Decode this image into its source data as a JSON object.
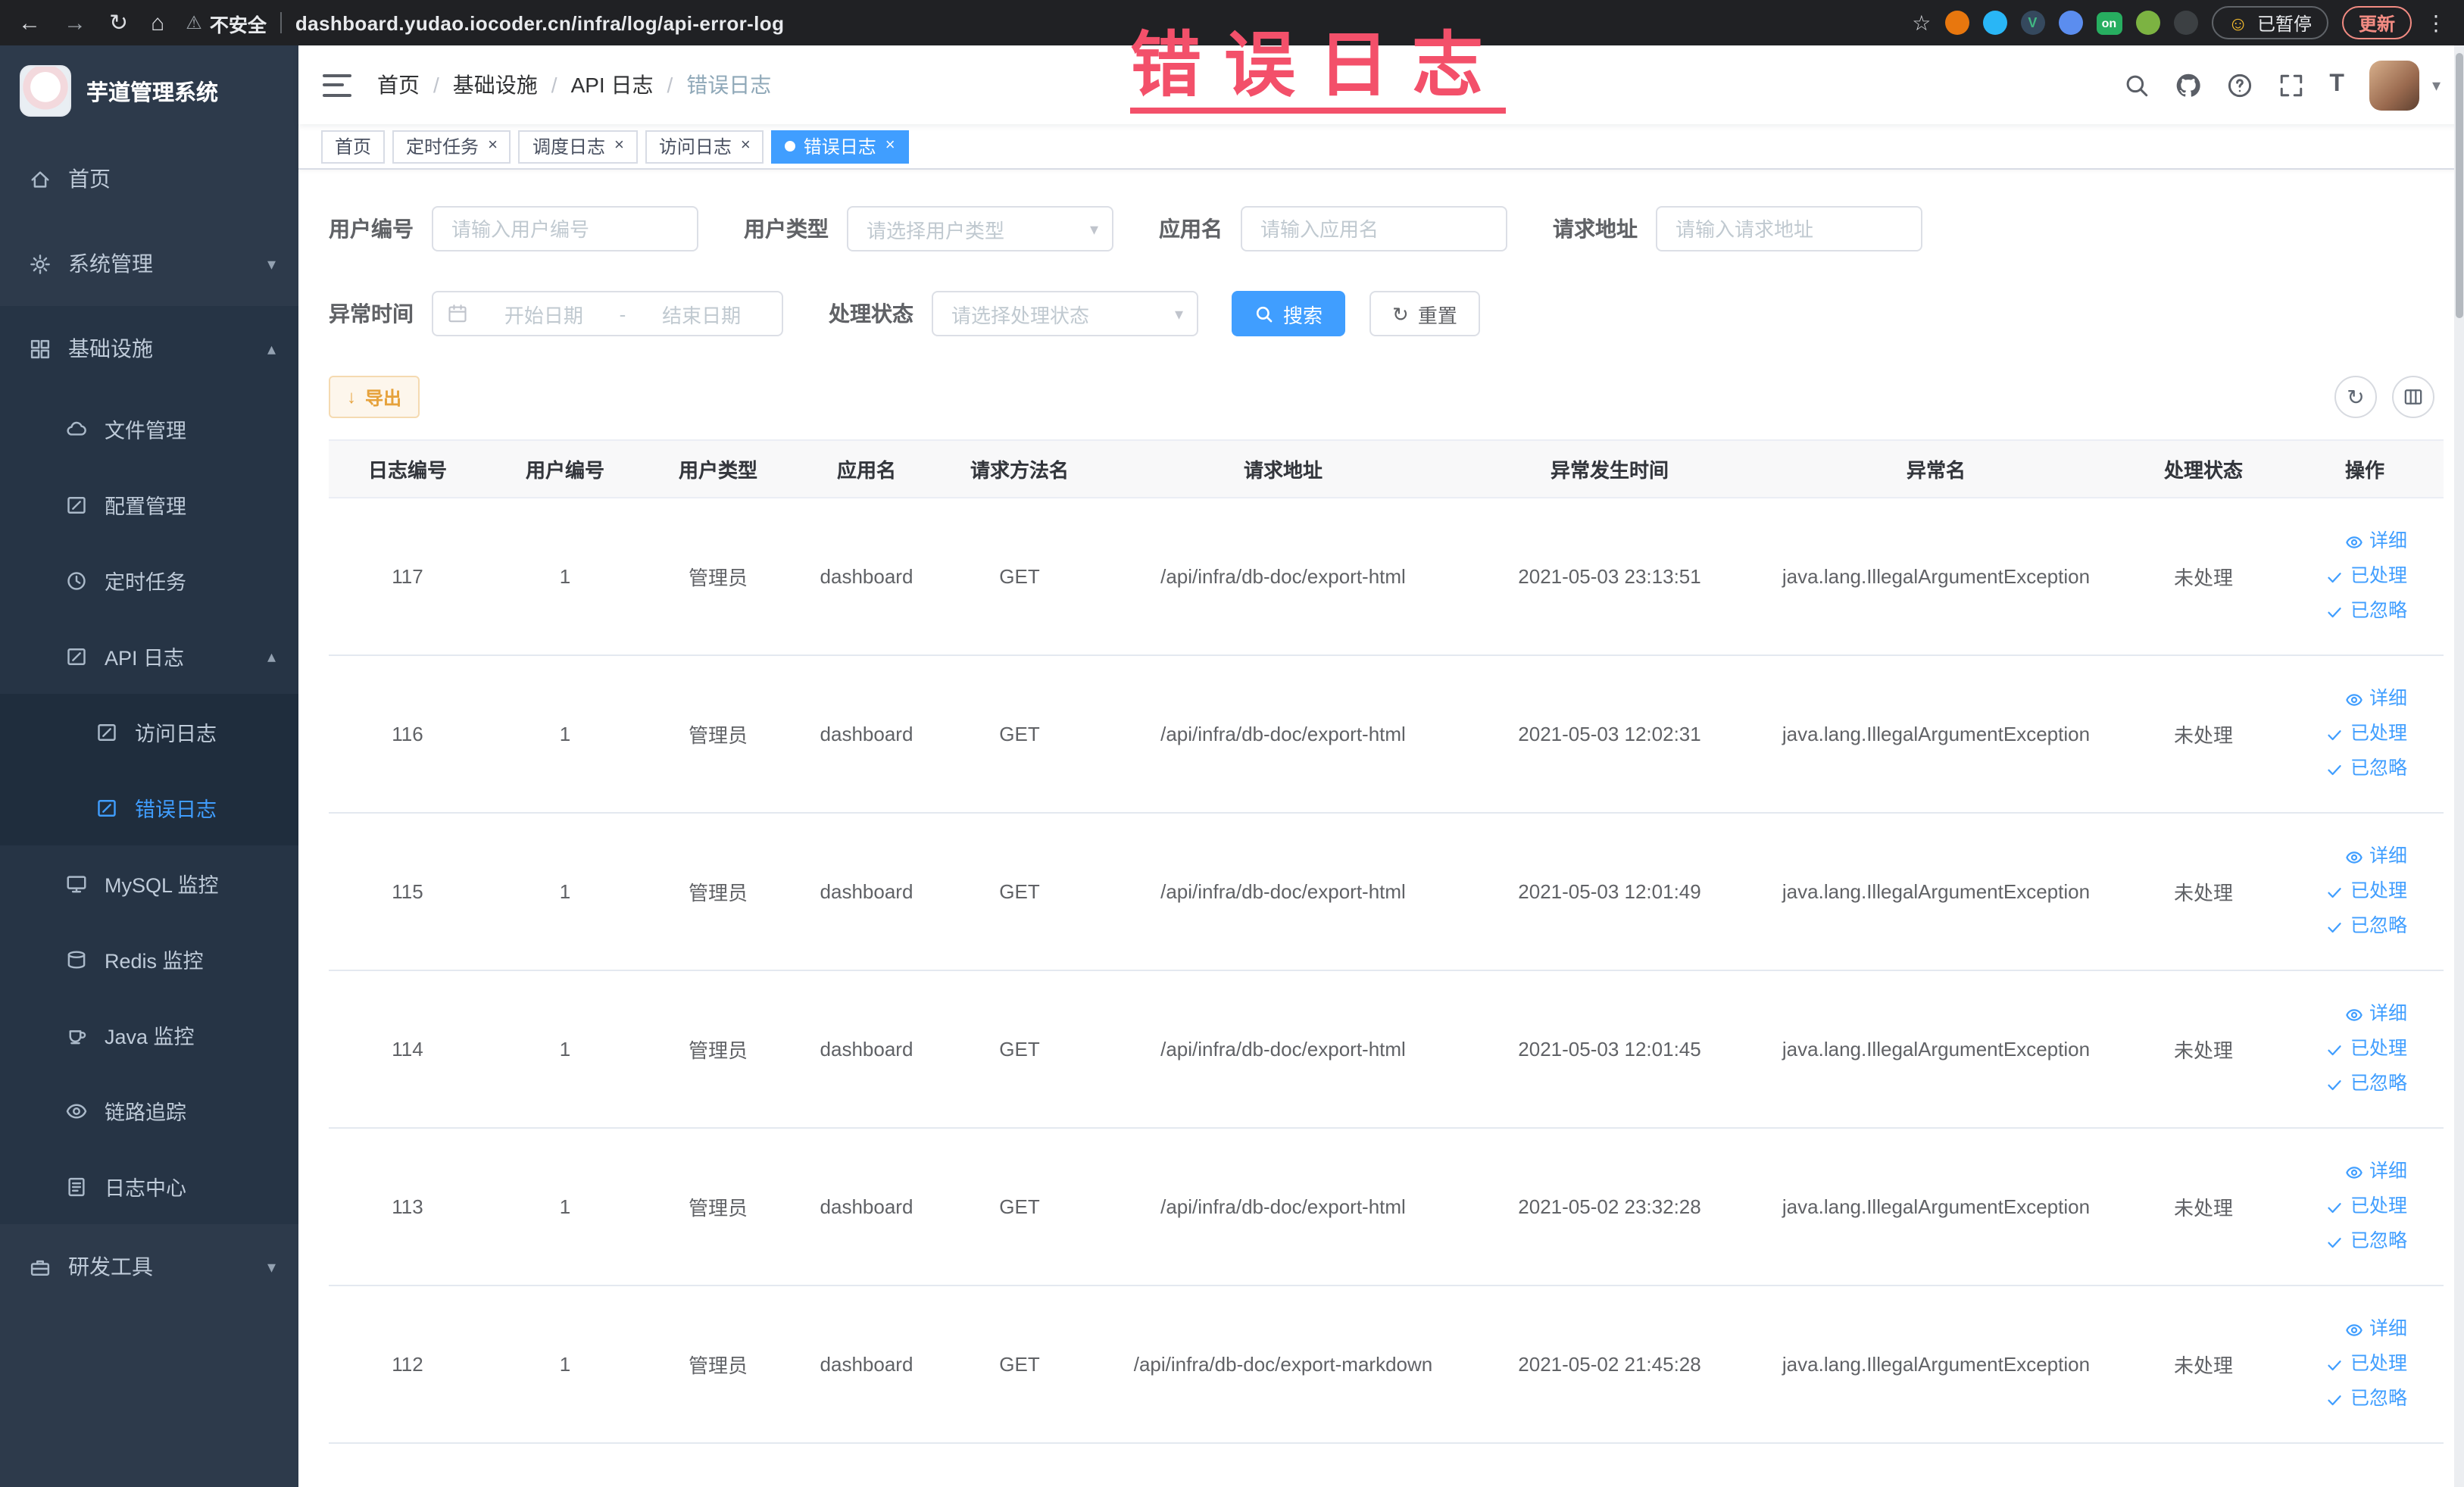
{
  "colors": {
    "accent": "#409eff",
    "warning": "#e6a23c",
    "annotation_red": "#f3506a",
    "sidebar_bg": "#2d3a4b",
    "sidebar_submenu_bg": "#263445",
    "sidebar_nested_bg": "#1f2d3d",
    "active_tab_bg": "#409eff"
  },
  "browser": {
    "security_label": "不安全",
    "url": "dashboard.yudao.iocoder.cn/infra/log/api-error-log",
    "extensions": {
      "vue_badge": "V",
      "on_badge": "on"
    },
    "paused_button": "已暂停",
    "update_button": "更新"
  },
  "annotation": {
    "text": "错误日志"
  },
  "icons": {
    "back": "←",
    "forward": "→",
    "reload": "↻",
    "home": "⌂",
    "warning": "⚠",
    "star": "☆",
    "kebab": "⋮",
    "smiley": "☺",
    "caret_down": "▾",
    "chevron_down": "▾",
    "chevron_up": "▴",
    "refresh": "↻",
    "download": "↓",
    "font_size": "T"
  },
  "sidebar": {
    "logo_title": "芋道管理系统",
    "items": [
      {
        "label": "首页"
      },
      {
        "label": "系统管理"
      },
      {
        "label": "基础设施",
        "children": [
          {
            "label": "文件管理"
          },
          {
            "label": "配置管理"
          },
          {
            "label": "定时任务"
          },
          {
            "label": "API 日志",
            "children": [
              {
                "label": "访问日志"
              },
              {
                "label": "错误日志"
              }
            ]
          },
          {
            "label": "MySQL 监控"
          },
          {
            "label": "Redis 监控"
          },
          {
            "label": "Java 监控"
          },
          {
            "label": "链路追踪"
          },
          {
            "label": "日志中心"
          }
        ]
      },
      {
        "label": "研发工具"
      }
    ]
  },
  "navbar": {
    "breadcrumb": [
      "首页",
      "基础设施",
      "API 日志",
      "错误日志"
    ]
  },
  "tabs": [
    {
      "label": "首页"
    },
    {
      "label": "定时任务"
    },
    {
      "label": "调度日志"
    },
    {
      "label": "访问日志"
    },
    {
      "label": "错误日志"
    }
  ],
  "filters": {
    "user_id_label": "用户编号",
    "user_id_placeholder": "请输入用户编号",
    "user_type_label": "用户类型",
    "user_type_placeholder": "请选择用户类型",
    "app_name_label": "应用名",
    "app_name_placeholder": "请输入应用名",
    "request_url_label": "请求地址",
    "request_url_placeholder": "请输入请求地址",
    "exception_time_label": "异常时间",
    "start_placeholder": "开始日期",
    "range_separator": "-",
    "end_placeholder": "结束日期",
    "process_status_label": "处理状态",
    "process_status_placeholder": "请选择处理状态",
    "search_button": "搜索",
    "reset_button": "重置"
  },
  "toolbar": {
    "export_button": "导出"
  },
  "table": {
    "headers": [
      "日志编号",
      "用户编号",
      "用户类型",
      "应用名",
      "请求方法名",
      "请求地址",
      "异常发生时间",
      "异常名",
      "处理状态",
      "操作"
    ],
    "actions": [
      {
        "label": "详细",
        "icon": "eye"
      },
      {
        "label": "已处理",
        "icon": "check"
      },
      {
        "label": "已忽略",
        "icon": "check"
      }
    ],
    "rows": [
      {
        "id": "117",
        "user_id": "1",
        "user_type": "管理员",
        "app": "dashboard",
        "method": "GET",
        "url": "/api/infra/db-doc/export-html",
        "time": "2021-05-03 23:13:51",
        "exception": "java.lang.IllegalArgumentException",
        "status": "未处理"
      },
      {
        "id": "116",
        "user_id": "1",
        "user_type": "管理员",
        "app": "dashboard",
        "method": "GET",
        "url": "/api/infra/db-doc/export-html",
        "time": "2021-05-03 12:02:31",
        "exception": "java.lang.IllegalArgumentException",
        "status": "未处理"
      },
      {
        "id": "115",
        "user_id": "1",
        "user_type": "管理员",
        "app": "dashboard",
        "method": "GET",
        "url": "/api/infra/db-doc/export-html",
        "time": "2021-05-03 12:01:49",
        "exception": "java.lang.IllegalArgumentException",
        "status": "未处理"
      },
      {
        "id": "114",
        "user_id": "1",
        "user_type": "管理员",
        "app": "dashboard",
        "method": "GET",
        "url": "/api/infra/db-doc/export-html",
        "time": "2021-05-03 12:01:45",
        "exception": "java.lang.IllegalArgumentException",
        "status": "未处理"
      },
      {
        "id": "113",
        "user_id": "1",
        "user_type": "管理员",
        "app": "dashboard",
        "method": "GET",
        "url": "/api/infra/db-doc/export-html",
        "time": "2021-05-02 23:32:28",
        "exception": "java.lang.IllegalArgumentException",
        "status": "未处理"
      },
      {
        "id": "112",
        "user_id": "1",
        "user_type": "管理员",
        "app": "dashboard",
        "method": "GET",
        "url": "/api/infra/db-doc/export-markdown",
        "time": "2021-05-02 21:45:28",
        "exception": "java.lang.IllegalArgumentException",
        "status": "未处理"
      }
    ]
  }
}
